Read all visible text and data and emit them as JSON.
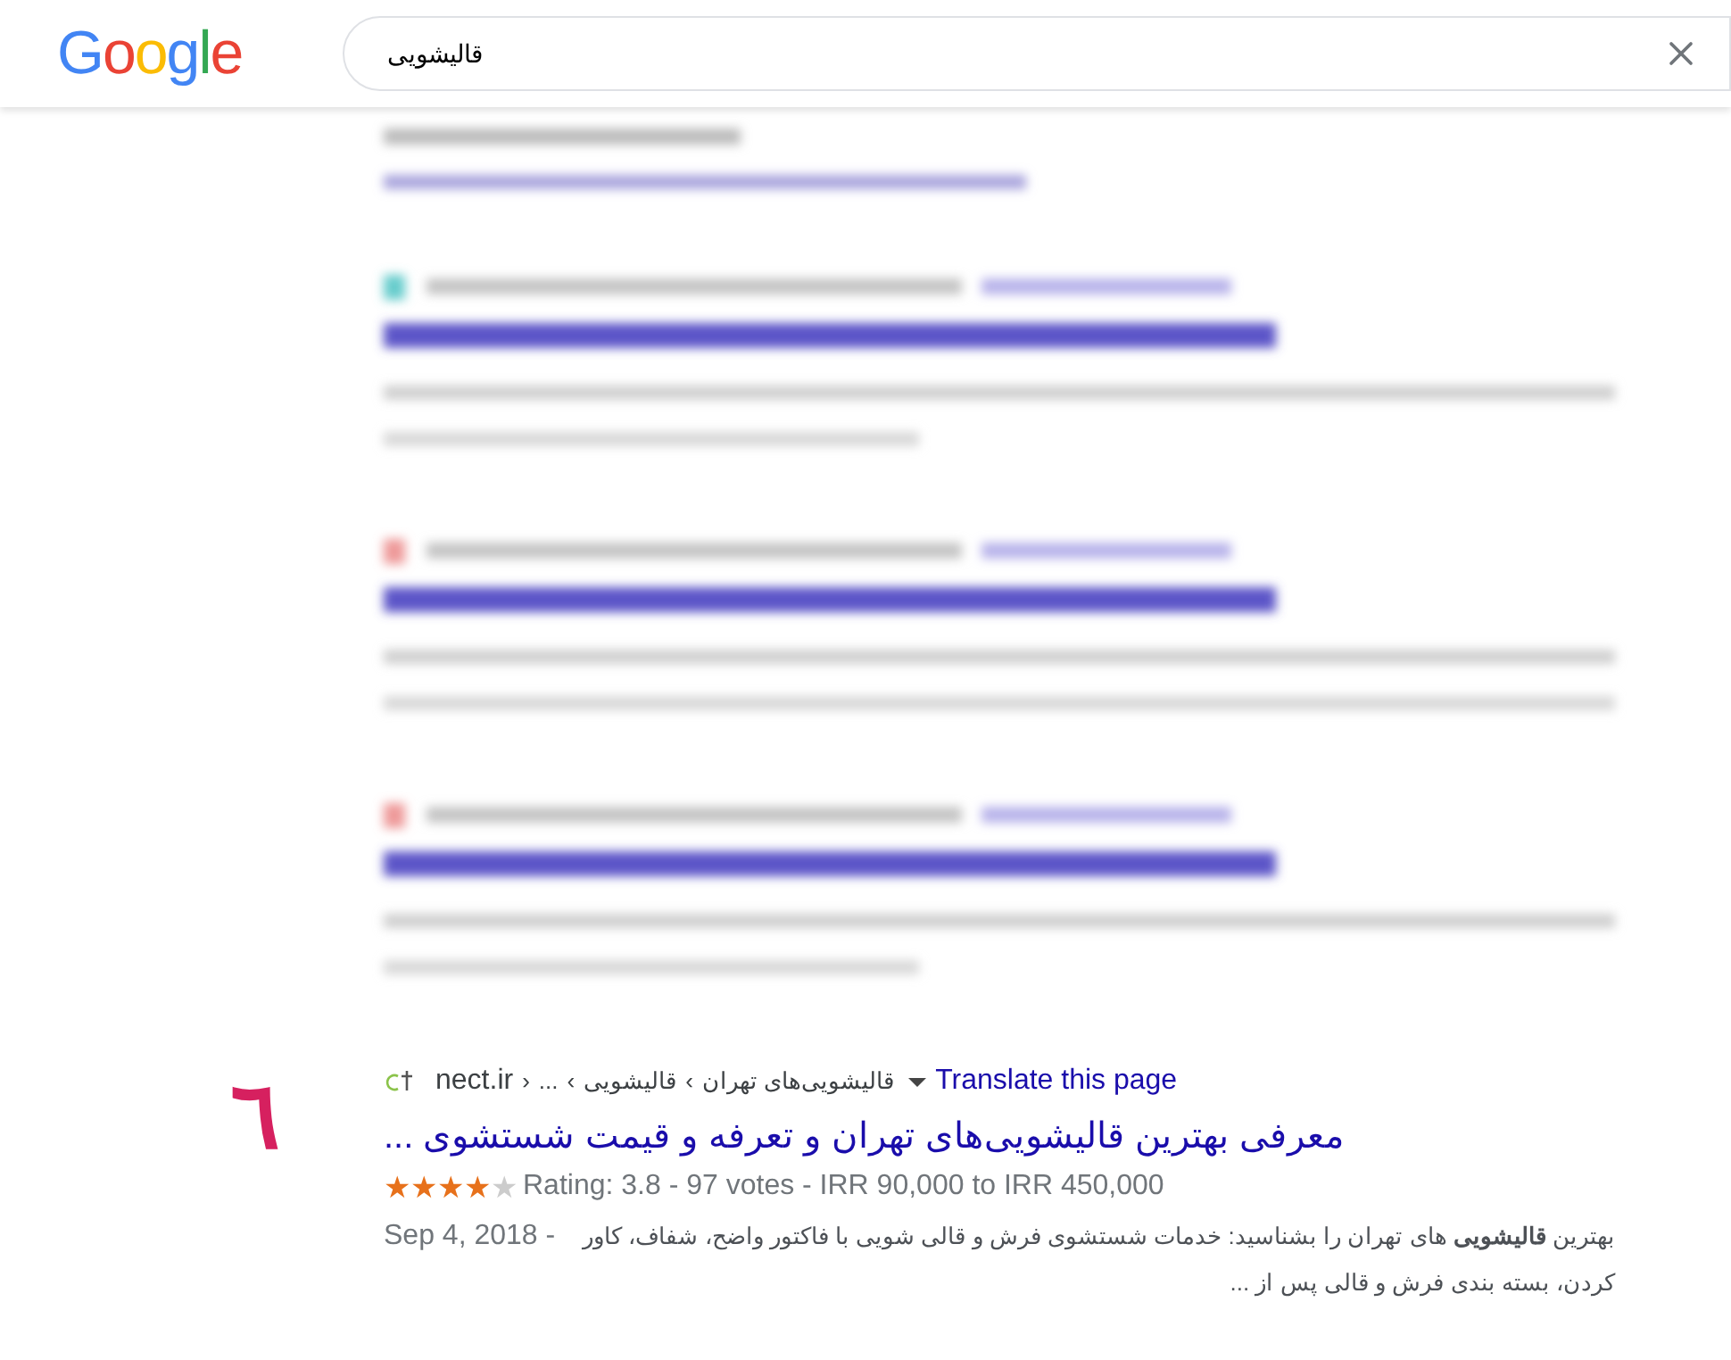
{
  "header": {
    "logo": "Google",
    "search": {
      "value": "قالیشویی"
    }
  },
  "result": {
    "annotation": "٦",
    "breadcrumb": [
      {
        "kind": "crumb",
        "text": "قالیشویی‌های تهران"
      },
      {
        "kind": "sep",
        "text": "‹"
      },
      {
        "kind": "crumb",
        "text": "قالیشویی"
      },
      {
        "kind": "sep",
        "text": "‹"
      },
      {
        "kind": "crumb",
        "text": "..."
      },
      {
        "kind": "sep",
        "text": "›"
      },
      {
        "kind": "domain",
        "text": "nect.ir"
      }
    ],
    "translate": "Translate this page",
    "title": "معرفی بهترین قالیشویی‌های تهران و تعرفه و قیمت شستشوی ...",
    "stars": 4,
    "rating": "Rating: 3.8 - 97 votes - IRR 90,000 to IRR 450,000",
    "date": "Sep 4, 2018 -",
    "snippet_lines": [
      "بهترین **قالیشویی** های تهران را بشناسید: خدمات شستشوی فرش و قالی شویی با فاکتور واضح، شفاف، کاور",
      "کردن، بسته بندی فرش و قالی پس از ..."
    ]
  }
}
